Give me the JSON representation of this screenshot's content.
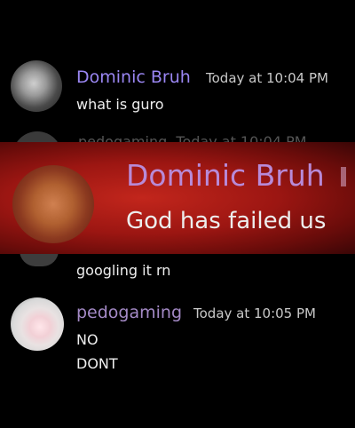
{
  "messages": [
    {
      "username": "Dominic Bruh",
      "timestamp": "Today at 10:04 PM",
      "lines": [
        "what is guro"
      ]
    },
    {
      "username": "pedogaming",
      "timestamp": "Today at 10:04 PM",
      "lines": [
        "googling it rn"
      ]
    },
    {
      "username": "pedogaming",
      "timestamp": "Today at 10:05 PM",
      "lines": [
        "NO",
        "DONT"
      ]
    }
  ],
  "zoom_overlay": {
    "username": "Dominic Bruh",
    "text": "God has failed us"
  },
  "colors": {
    "background": "#000000",
    "username_blue": "#9a86f2",
    "username_pink": "#a48ac6",
    "overlay_red": "#9c1612"
  }
}
